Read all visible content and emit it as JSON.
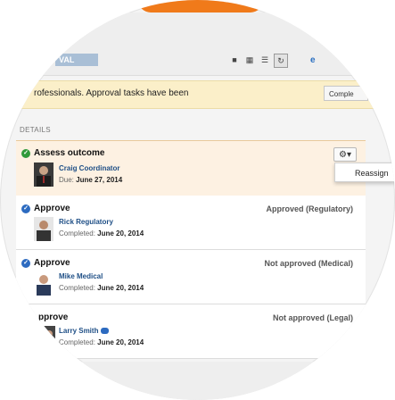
{
  "toolbar": {
    "approval_label": "VAL",
    "view_icons": [
      "list-view-icon",
      "split-view-icon",
      "grid-view-icon",
      "refresh-icon"
    ],
    "browser_icon": "ie-icon"
  },
  "notice": {
    "text": "rofessionals. Approval tasks have been",
    "complete_label": "Comple"
  },
  "details": {
    "heading": "DETAILS"
  },
  "tasks": [
    {
      "title": "Assess outcome",
      "person": "Craig Coordinator",
      "date_prefix": "Due:",
      "date": "June 27, 2014",
      "outcome": "",
      "icon": "green-check-circle",
      "menu_item": "Reassign"
    },
    {
      "title": "Approve",
      "person": "Rick Regulatory",
      "date_prefix": "Completed:",
      "date": "June 20, 2014",
      "outcome": "Approved (Regulatory)",
      "icon": "blue-check-circle"
    },
    {
      "title": "Approve",
      "person": "Mike Medical",
      "date_prefix": "Completed:",
      "date": "June 20, 2014",
      "outcome": "Not approved (Medical)",
      "icon": "blue-check-circle"
    },
    {
      "title": "pprove",
      "person": "Larry Smith",
      "date_prefix": "Completed:",
      "date": "June 20, 2014",
      "outcome": "Not approved (Legal)",
      "icon": "blue-check-circle"
    }
  ]
}
